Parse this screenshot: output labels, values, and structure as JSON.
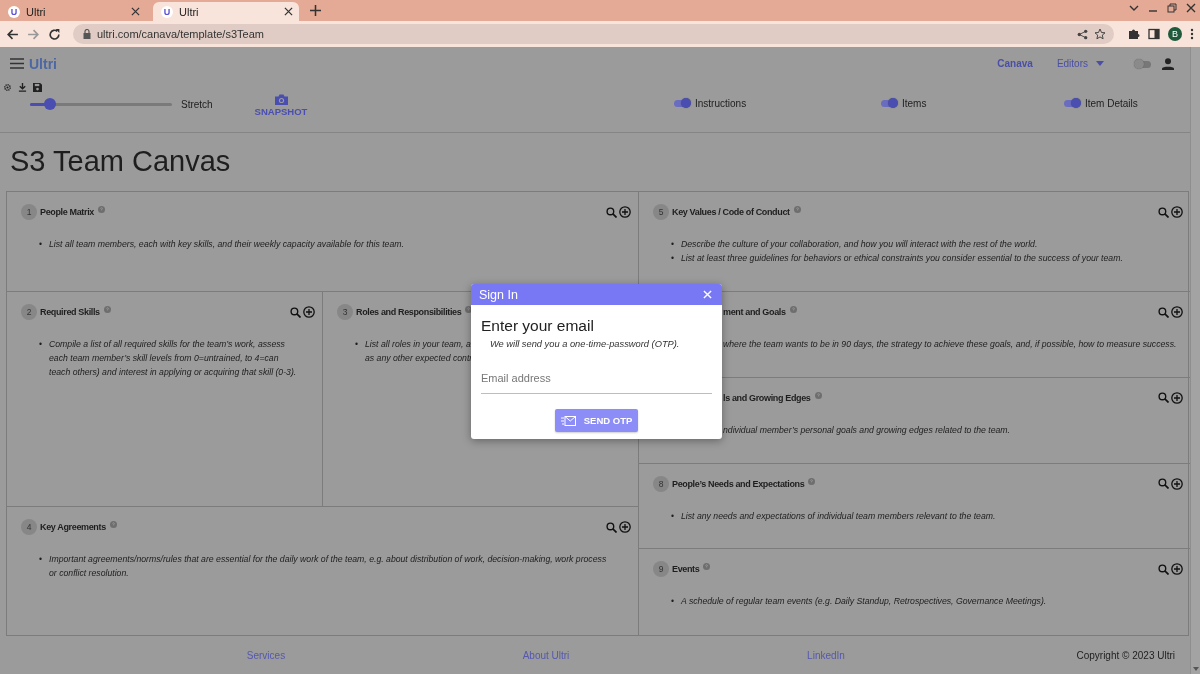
{
  "browser": {
    "tabs": [
      {
        "icon_letter": "U",
        "title": "Ultri",
        "selected": false
      },
      {
        "icon_letter": "U",
        "title": "Ultri",
        "selected": true
      }
    ],
    "url": "ultri.com/canava/template/s3Team",
    "profile_initial": "B"
  },
  "app_bar": {
    "brand": "Ultri",
    "nav": [
      {
        "label": "Canava",
        "kind": "link"
      },
      {
        "label": "Editors",
        "kind": "menu"
      }
    ],
    "mode_toggle": {
      "on": false
    }
  },
  "toolbar": {
    "zoom_slider": {
      "level": 0.14
    },
    "slider_label": "Stretch",
    "snapshot": "SNAPSHOT",
    "toggles": [
      {
        "label": "Instructions",
        "on": true
      },
      {
        "label": "Items",
        "on": true
      },
      {
        "label": "Item Details",
        "on": true
      }
    ]
  },
  "title": "S3 Team Canvas",
  "canvas": {
    "columns": [
      {
        "blocks": [
          {
            "kind": "card",
            "number": "1",
            "title": "People Matrix",
            "tools": true,
            "bullets": [
              {
                "marker": "•",
                "text": "List all team members, each with key skills, and their weekly capacity available for this team."
              }
            ]
          },
          {
            "kind": "split",
            "cards": [
              {
                "number": "2",
                "title": "Required Skills",
                "tools": true,
                "bullets": [
                  {
                    "marker": "•",
                    "text": "Compile a list of all required skills for the team’s work, assess each team member’s skill levels from 0=untrained, to 4=can teach others) and interest in applying or acquiring that skill (0-3)."
                  }
                ]
              },
              {
                "number": "3",
                "title": "Roles and Responsibilities",
                "tools": false,
                "bullets": [
                  {
                    "marker": "•",
                    "lines": [
                      "List all roles in your team, a",
                      "as any other expected contr"
                    ]
                  }
                ]
              }
            ]
          },
          {
            "kind": "card",
            "number": "4",
            "title": "Key Agreements",
            "tools": true,
            "bullets": [
              {
                "marker": "•",
                "text": "Important agreements/norms/rules that are essential for the daily work of the team, e.g. about distribution of work, decision-making, work process or conflict resolution."
              }
            ]
          }
        ]
      },
      {
        "blocks": [
          {
            "kind": "card",
            "number": "5",
            "title": "Key Values / Code of Conduct",
            "tools": true,
            "bullets": [
              {
                "marker": "•",
                "text": "Describe the culture of your collaboration, and how you will interact with the rest of the world."
              },
              {
                "marker": "•",
                "text": "List at least three guidelines for behaviors or ethical constraints you consider essential to the success of your team."
              }
            ]
          },
          {
            "kind": "card",
            "title": "ment and Goals",
            "tools": true,
            "bullets": [
              {
                "text": "where the team wants to be in 90 days, the strategy to achieve these goals, and, if possible, how to measure success."
              }
            ]
          },
          {
            "kind": "card",
            "title": "ls and Growing Edges",
            "tools": true,
            "bullets": [
              {
                "text": "ndividual member’s personal goals and growing edges related to the team."
              }
            ]
          },
          {
            "kind": "card",
            "number": "8",
            "title": "People’s Needs and Expectations",
            "tools": true,
            "bullets": [
              {
                "marker": "•",
                "text": "List any needs and expectations of individual team members relevant to the team."
              }
            ]
          },
          {
            "kind": "card",
            "number": "9",
            "title": "Events",
            "tools": true,
            "bullets": [
              {
                "marker": "•",
                "text": "A schedule of regular team events (e.g. Daily Standup, Retrospectives, Governance Meetings)."
              }
            ]
          }
        ]
      }
    ]
  },
  "dialog": {
    "title": "Sign In",
    "heading": "Enter your email",
    "subtitle": "We will send you a one-time-password (OTP).",
    "email": {
      "placeholder": "Email address"
    },
    "button": "SEND OTP"
  },
  "footer": {
    "links": [
      "Services",
      "About Ultri",
      "LinkedIn"
    ],
    "copyright": "Copyright © 2023 Ultri"
  }
}
